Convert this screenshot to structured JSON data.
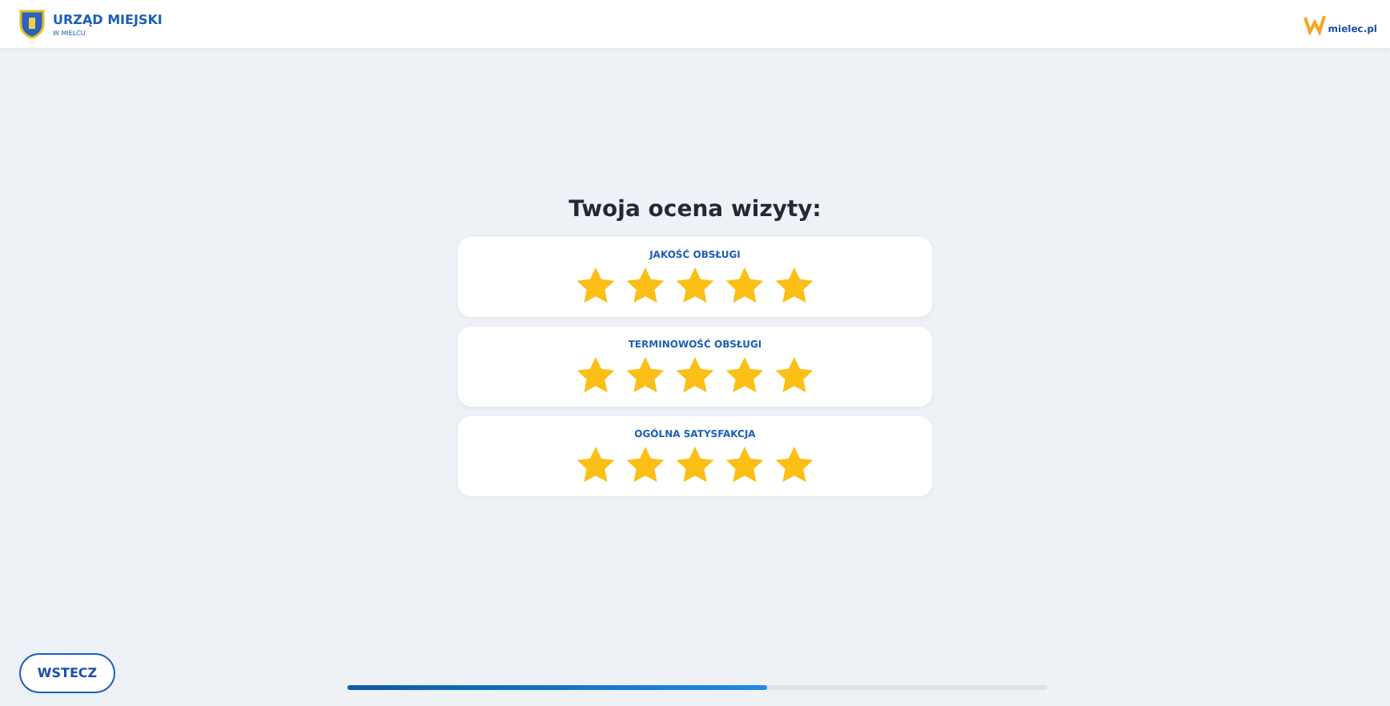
{
  "header": {
    "title": "URZĄD MIEJSKI",
    "subtitle": "W MIELCU",
    "partner": "mielec.pl"
  },
  "heading": "Twoja ocena wizyty:",
  "ratings": [
    {
      "label": "JAKOŚĆ OBSŁUGI",
      "stars": 5
    },
    {
      "label": "TERMINOWOŚĆ OBSŁUGI",
      "stars": 5
    },
    {
      "label": "OGÓLNA SATYSFAKCJA",
      "stars": 5
    }
  ],
  "back_button": "WSTECZ",
  "progress": {
    "level": 0.6
  }
}
